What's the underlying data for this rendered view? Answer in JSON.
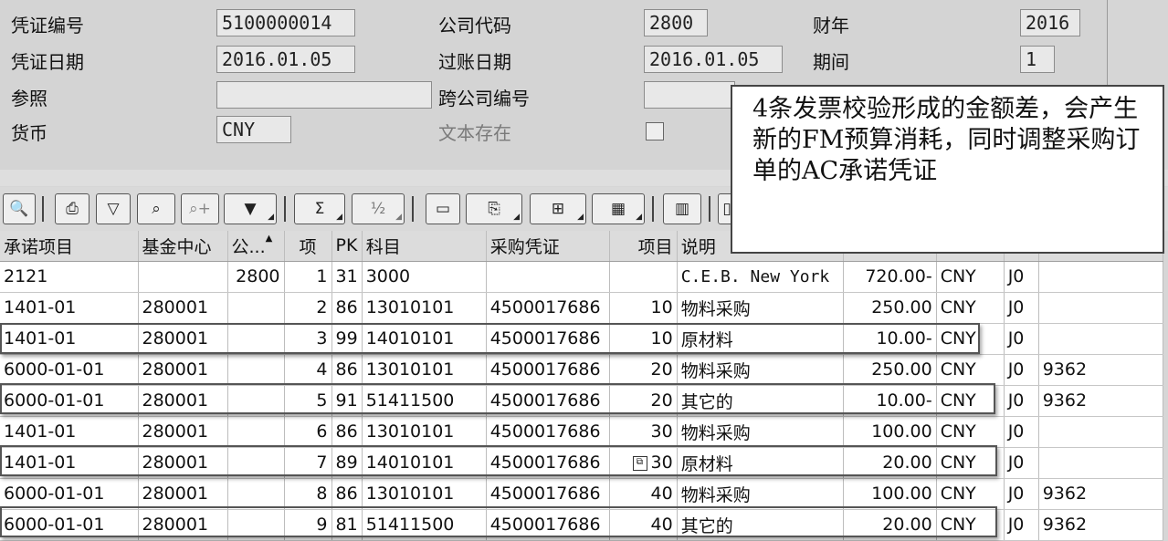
{
  "header": {
    "doc_no_label": "凭证编号",
    "doc_no": "5100000014",
    "company_label": "公司代码",
    "company": "2800",
    "year_label": "财年",
    "year": "2016",
    "doc_date_label": "凭证日期",
    "doc_date": "2016.01.05",
    "post_date_label": "过账日期",
    "post_date": "2016.01.05",
    "period_label": "期间",
    "period": "1",
    "ref_label": "参照",
    "ref": "",
    "cross_label": "跨公司编号",
    "cross": "",
    "currency_label": "货币",
    "currency": "CNY",
    "text_label": "文本存在"
  },
  "toolbar": {
    "buttons": [
      "detail-icon",
      "print-icon",
      "filter-icon",
      "find-icon",
      "find-next-icon",
      "set-filter-icon",
      "sum-icon",
      "subtotal-icon",
      "print-preview-icon",
      "export-icon",
      "spreadsheet-icon",
      "layout-icon",
      "views-icon"
    ]
  },
  "note": {
    "text": "4条发票校验形成的金额差，会产生新的FM预算消耗，同时调整采购订单的AC承诺凭证"
  },
  "grid": {
    "columns": [
      "承诺项目",
      "基金中心",
      "公...",
      "项",
      "PK",
      "科目",
      "采购凭证",
      "项目",
      "说明",
      "",
      "",
      "",
      ""
    ],
    "rows": [
      [
        "2121",
        "",
        "2800",
        "1",
        "31",
        "3000",
        "",
        "",
        "C.E.B. New York",
        "720.00-",
        "CNY",
        "J0",
        ""
      ],
      [
        "1401-01",
        "280001",
        "",
        "2",
        "86",
        "13010101",
        "4500017686",
        "10",
        "物料采购",
        "250.00",
        "CNY",
        "J0",
        ""
      ],
      [
        "1401-01",
        "280001",
        "",
        "3",
        "99",
        "14010101",
        "4500017686",
        "10",
        "原材料",
        "10.00-",
        "CNY",
        "J0",
        ""
      ],
      [
        "6000-01-01",
        "280001",
        "",
        "4",
        "86",
        "13010101",
        "4500017686",
        "20",
        "物料采购",
        "250.00",
        "CNY",
        "J0",
        "9362"
      ],
      [
        "6000-01-01",
        "280001",
        "",
        "5",
        "91",
        "51411500",
        "4500017686",
        "20",
        "其它的",
        "10.00-",
        "CNY",
        "J0",
        "9362"
      ],
      [
        "1401-01",
        "280001",
        "",
        "6",
        "86",
        "13010101",
        "4500017686",
        "30",
        "物料采购",
        "100.00",
        "CNY",
        "J0",
        ""
      ],
      [
        "1401-01",
        "280001",
        "",
        "7",
        "89",
        "14010101",
        "4500017686",
        "30",
        "原材料",
        "20.00",
        "CNY",
        "J0",
        ""
      ],
      [
        "6000-01-01",
        "280001",
        "",
        "8",
        "86",
        "13010101",
        "4500017686",
        "40",
        "物料采购",
        "100.00",
        "CNY",
        "J0",
        "9362"
      ],
      [
        "6000-01-01",
        "280001",
        "",
        "9",
        "81",
        "51411500",
        "4500017686",
        "40",
        "其它的",
        "20.00",
        "CNY",
        "J0",
        "9362"
      ]
    ]
  }
}
